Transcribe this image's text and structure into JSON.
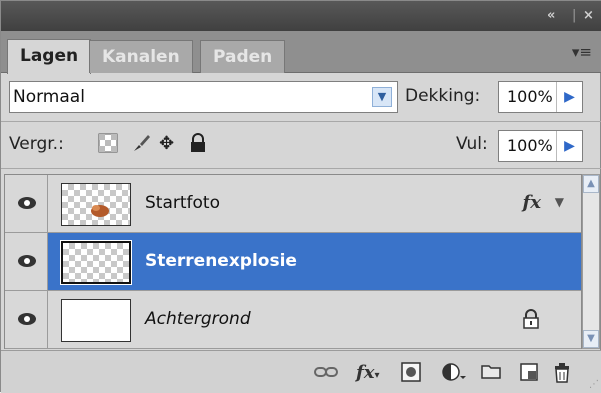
{
  "window": {
    "collapse_icon": "«",
    "close_icon": "×"
  },
  "tabs": [
    {
      "label": "Lagen",
      "active": true
    },
    {
      "label": "Kanalen",
      "active": false
    },
    {
      "label": "Paden",
      "active": false
    }
  ],
  "blend": {
    "mode": "Normaal",
    "opacity_label": "Dekking:",
    "opacity_value": "100%"
  },
  "lock_row": {
    "label": "Vergr.:",
    "fill_label": "Vul:",
    "fill_value": "100%"
  },
  "layers": [
    {
      "name": "Startfoto",
      "has_fx": true,
      "selected": false,
      "locked": false
    },
    {
      "name": "Sterrenexplosie",
      "has_fx": false,
      "selected": true,
      "locked": false
    },
    {
      "name": "Achtergrond",
      "has_fx": false,
      "selected": false,
      "locked": true
    }
  ],
  "icons": {
    "eye": "eye-icon",
    "fx": "fx",
    "link": "link-icon",
    "mask": "mask-icon",
    "adjustment": "adjustment-icon",
    "folder": "folder-icon",
    "new_layer": "new-layer-icon",
    "trash": "trash-icon"
  },
  "colors": {
    "selection": "#3a73c9",
    "accent_arrow": "#2f68c8"
  }
}
